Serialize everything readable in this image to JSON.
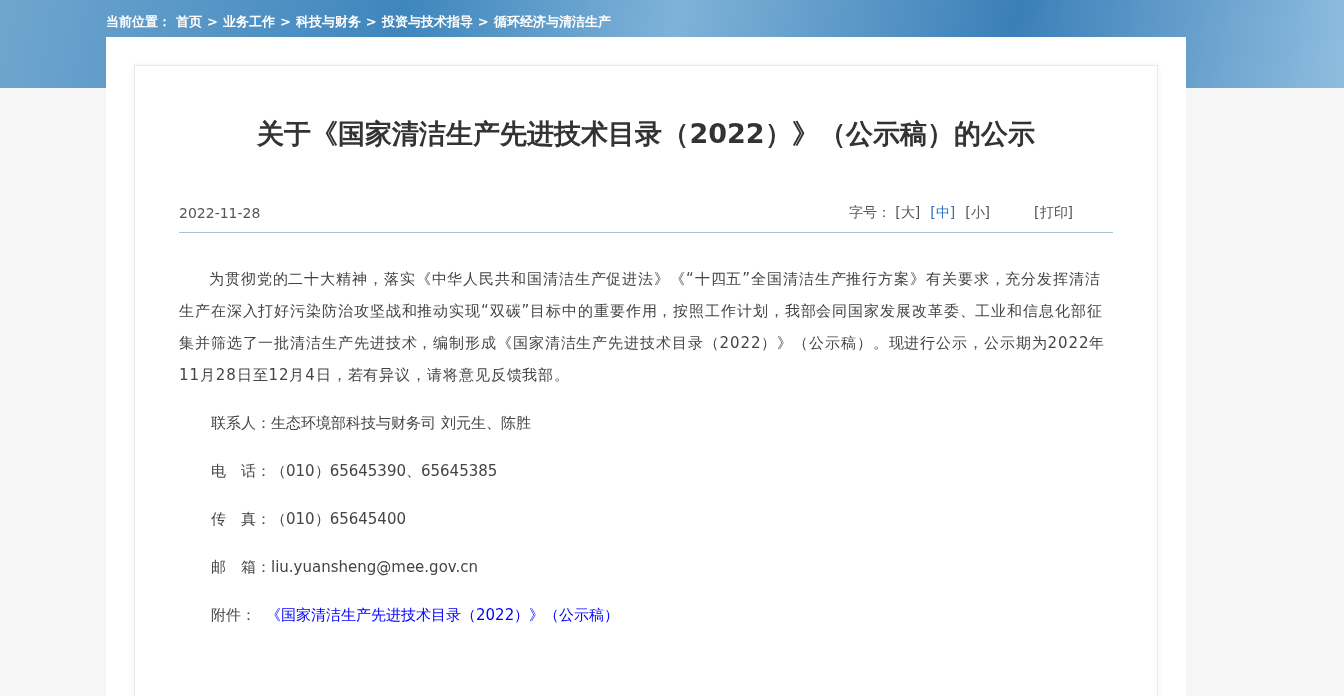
{
  "breadcrumb": {
    "label": "当前位置：",
    "items": [
      {
        "text": "首页",
        "separator": ">"
      },
      {
        "text": "业务工作",
        "separator": ">"
      },
      {
        "text": "科技与财务",
        "separator": ">"
      },
      {
        "text": "投资与技术指导",
        "separator": ">"
      },
      {
        "text": "循环经济与清洁生产"
      }
    ]
  },
  "article": {
    "title": "关于《国家清洁生产先进技术目录（2022）》（公示稿）的公示",
    "date": "2022-11-28",
    "font_size_label": "字号：",
    "font_sizes": [
      {
        "label": "[大]",
        "selected": false
      },
      {
        "label": "[中]",
        "selected": true
      },
      {
        "label": "[小]",
        "selected": false
      }
    ],
    "print": "[打印]",
    "body": "为贯彻党的二十大精神，落实《中华人民共和国清洁生产促进法》《“十四五”全国清洁生产推行方案》有关要求，充分发挥清洁生产在深入打好污染防治攻坚战和推动实现“双碳”目标中的重要作用，按照工作计划，我部会同国家发展改革委、工业和信息化部征集并筛选了一批清洁生产先进技术，编制形成《国家清洁生产先进技术目录（2022）》（公示稿）。现进行公示，公示期为2022年11月28日至12月4日，若有异议，请将意见反馈我部。",
    "contacts": [
      {
        "kind": "text",
        "label": "联系人：",
        "value": "生态环境部科技与财务司 刘元生、陈胜"
      },
      {
        "kind": "text",
        "label": "电　话：",
        "value": "（010）65645390、65645385"
      },
      {
        "kind": "text",
        "label": "传　真：",
        "value": "（010）65645400"
      },
      {
        "kind": "text",
        "label": "邮　箱：",
        "value": "liu.yuansheng@mee.gov.cn"
      },
      {
        "kind": "link",
        "label": "附件：",
        "value": "《国家清洁生产先进技术目录（2022）》（公示稿）"
      }
    ]
  }
}
